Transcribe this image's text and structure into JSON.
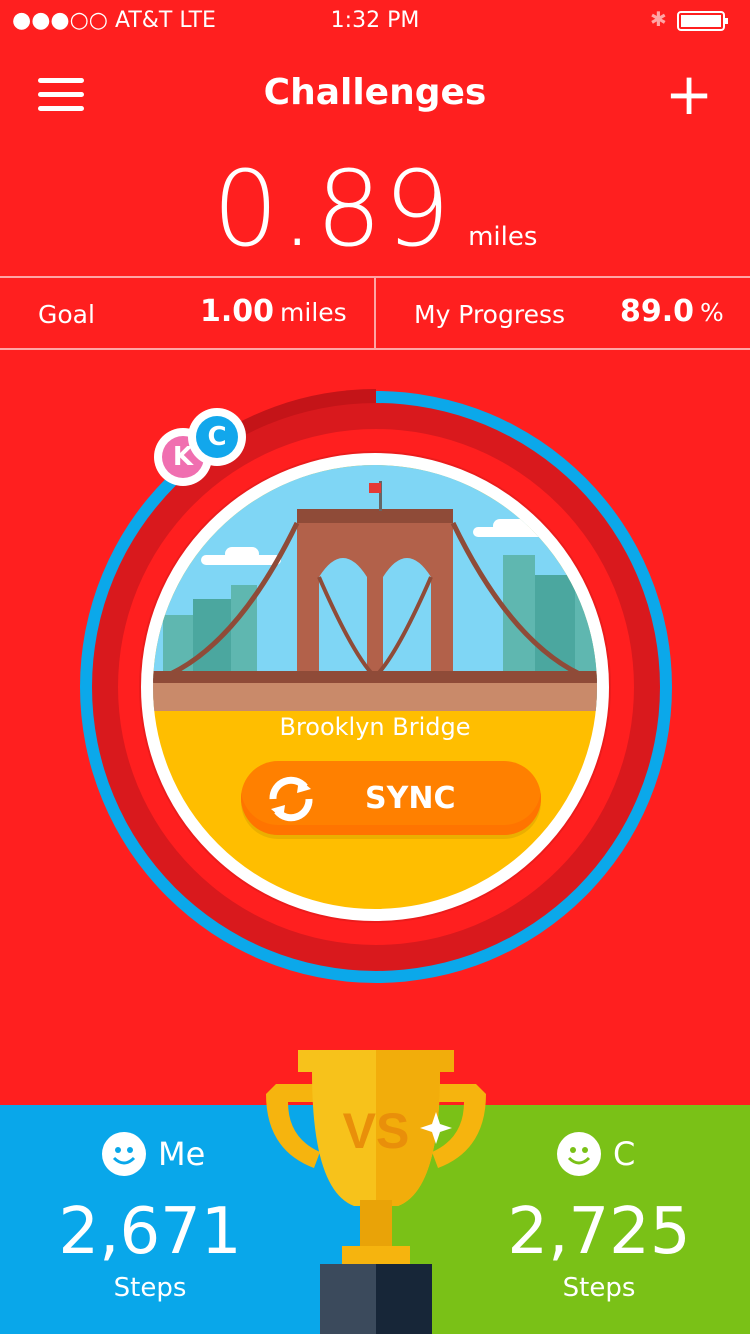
{
  "status_bar": {
    "carrier": "●●●○○ AT&T  LTE",
    "time": "1:32 PM"
  },
  "header": {
    "title": "Challenges",
    "menu_icon": "hamburger-icon",
    "add_icon": "plus-icon",
    "add_label": "+"
  },
  "distance": {
    "value": "0.89",
    "unit": "miles"
  },
  "stats": {
    "goal_label": "Goal",
    "goal_value": "1.00",
    "goal_unit": "miles",
    "progress_label": "My Progress",
    "progress_value": "89.0",
    "progress_unit": "%"
  },
  "progress_ring": {
    "fraction": 0.89
  },
  "avatars": [
    {
      "initial": "K",
      "color": "#f06fb0"
    },
    {
      "initial": "C",
      "color": "#12a7ec"
    }
  ],
  "landmark": {
    "name": "Brooklyn Bridge",
    "sync_label": "SYNC"
  },
  "versus": {
    "badge": "VS",
    "me": {
      "name": "Me",
      "steps": "2,671",
      "steps_label": "Steps"
    },
    "opponent": {
      "name": "C",
      "steps": "2,725",
      "steps_label": "Steps"
    }
  },
  "colors": {
    "background": "#ff1f1f",
    "ring_progress": "#0ba8ea",
    "ring_track": "#d9191d",
    "card": "#ffbe00",
    "sync": "#ff8000",
    "me_panel": "#09a7ea",
    "opponent_panel": "#7ac117"
  }
}
